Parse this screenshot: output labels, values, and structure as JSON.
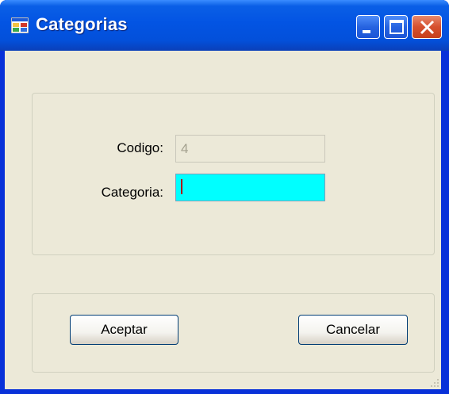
{
  "window": {
    "title": "Categorias",
    "icon": "form-icon",
    "controls": [
      "minimize-icon",
      "maximize-icon",
      "close-icon"
    ]
  },
  "form": {
    "codigo_label": "Codigo:",
    "codigo_value": "4",
    "categoria_label": "Categoria:",
    "categoria_value": ""
  },
  "buttons": {
    "accept_label": "Aceptar",
    "cancel_label": "Cancelar"
  },
  "colors": {
    "titlebar": "#0354e3",
    "client_background": "#ece9d8",
    "focused_input_background": "#00ffff",
    "close_button": "#d6502e"
  }
}
